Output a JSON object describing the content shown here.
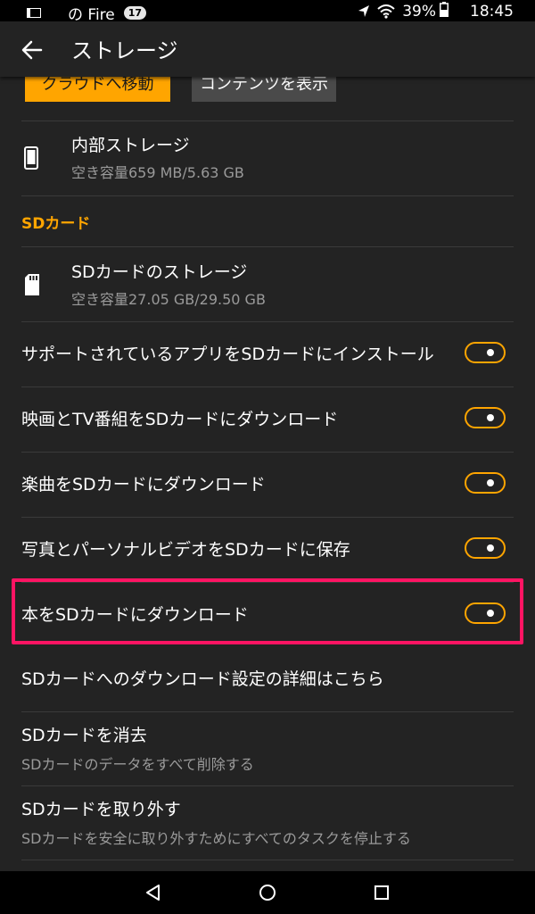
{
  "status_bar": {
    "notification_text": "の Fire",
    "badge": "17",
    "battery": "39%",
    "time": "18:45"
  },
  "app_bar": {
    "title": "ストレージ"
  },
  "buttons": {
    "move_to_cloud": "クラウドへ移動",
    "show_content": "コンテンツを表示"
  },
  "internal_storage": {
    "title": "内部ストレージ",
    "free_space": "空き容量659 MB/5.63 GB"
  },
  "sd_section": {
    "header": "SDカード"
  },
  "sd_storage": {
    "title": "SDカードのストレージ",
    "free_space": "空き容量27.05 GB/29.50 GB"
  },
  "toggles": [
    {
      "label": "サポートされているアプリをSDカードにインストール",
      "on": true
    },
    {
      "label": "映画とTV番組をSDカードにダウンロード",
      "on": true
    },
    {
      "label": "楽曲をSDカードにダウンロード",
      "on": true
    },
    {
      "label": "写真とパーソナルビデオをSDカードに保存",
      "on": true
    },
    {
      "label": "本をSDカードにダウンロード",
      "on": true
    }
  ],
  "details_link": "SDカードへのダウンロード設定の詳細はこちら",
  "erase_sd": {
    "title": "SDカードを消去",
    "subtitle": "SDカードのデータをすべて削除する"
  },
  "eject_sd": {
    "title": "SDカードを取り外す",
    "subtitle": "SDカードを安全に取り外すためにすべてのタスクを停止する"
  },
  "colors": {
    "accent": "#ffa500",
    "highlight": "#ff1463",
    "background": "#232323"
  }
}
